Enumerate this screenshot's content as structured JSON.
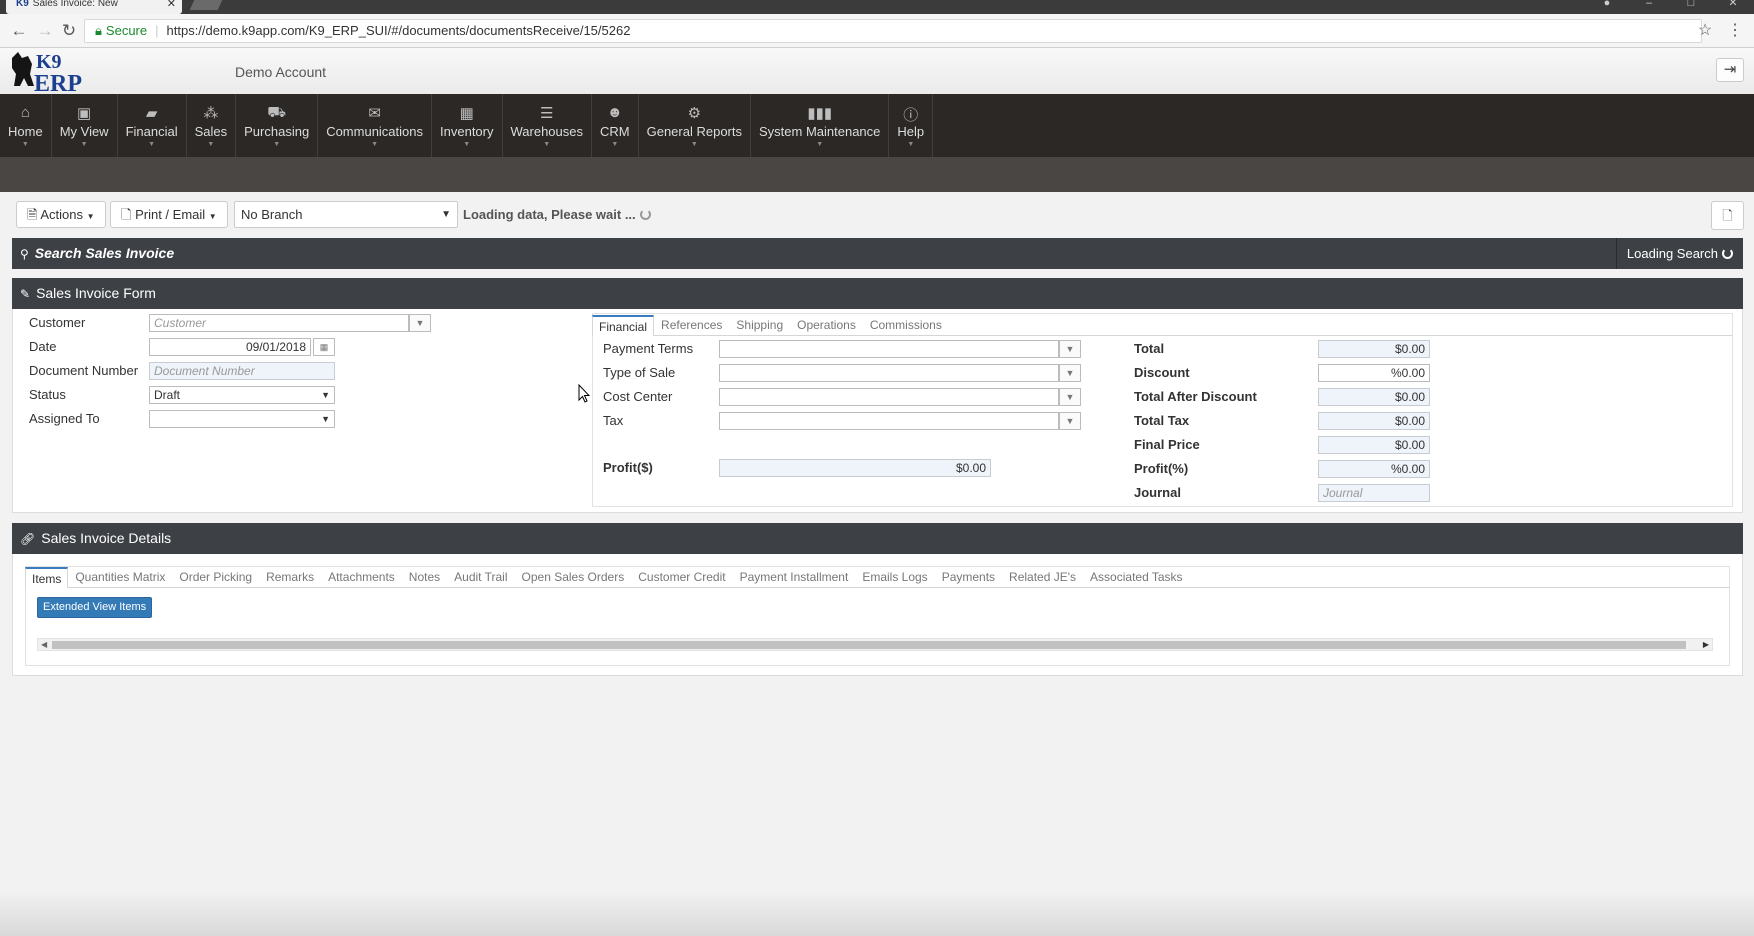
{
  "browser": {
    "tab_title": "Sales Invoice: New",
    "tab_favicon": "K9",
    "secure_label": "Secure",
    "url": "https://demo.k9app.com/K9_ERP_SUI/#/documents/documentsReceive/15/5262"
  },
  "header": {
    "logo_text": "K9 ERP",
    "account_name": "Demo Account"
  },
  "nav": {
    "items": [
      {
        "label": "Home",
        "icon": "home-icon"
      },
      {
        "label": "My View",
        "icon": "briefcase-icon"
      },
      {
        "label": "Financial",
        "icon": "book-icon"
      },
      {
        "label": "Sales",
        "icon": "cubes-icon"
      },
      {
        "label": "Purchasing",
        "icon": "cart-icon"
      },
      {
        "label": "Communications",
        "icon": "envelope-icon"
      },
      {
        "label": "Inventory",
        "icon": "table-icon"
      },
      {
        "label": "Warehouses",
        "icon": "server-icon"
      },
      {
        "label": "CRM",
        "icon": "users-icon"
      },
      {
        "label": "General Reports",
        "icon": "gear-icon"
      },
      {
        "label": "System Maintenance",
        "icon": "bar-chart-icon"
      },
      {
        "label": "Help",
        "icon": "info-icon"
      }
    ]
  },
  "actionbar": {
    "actions_label": "Actions",
    "print_label": "Print / Email",
    "branch_value": "No Branch",
    "loading_text": "Loading data, Please wait ..."
  },
  "search_panel": {
    "title": "Search Sales Invoice",
    "loading_label": "Loading Search"
  },
  "form_panel": {
    "title": "Sales Invoice Form",
    "customer_label": "Customer",
    "customer_placeholder": "Customer",
    "date_label": "Date",
    "date_value": "09/01/2018",
    "docnum_label": "Document Number",
    "docnum_placeholder": "Document Number",
    "status_label": "Status",
    "status_value": "Draft",
    "assigned_label": "Assigned To",
    "assigned_value": "",
    "tabs": [
      "Financial",
      "References",
      "Shipping",
      "Operations",
      "Commissions"
    ],
    "payment_terms_label": "Payment Terms",
    "type_of_sale_label": "Type of Sale",
    "cost_center_label": "Cost Center",
    "tax_label": "Tax",
    "profit_label": "Profit($)",
    "profit_value": "$0.00",
    "totals": [
      {
        "label": "Total",
        "value": "$0.00"
      },
      {
        "label": "Discount",
        "value": "%0.00"
      },
      {
        "label": "Total After Discount",
        "value": "$0.00"
      },
      {
        "label": "Total Tax",
        "value": "$0.00"
      },
      {
        "label": "Final Price",
        "value": "$0.00"
      },
      {
        "label": "Profit(%)",
        "value": "%0.00"
      }
    ],
    "journal_label": "Journal",
    "journal_placeholder": "Journal"
  },
  "details_panel": {
    "title": "Sales Invoice Details",
    "tabs": [
      "Items",
      "Quantities Matrix",
      "Order Picking",
      "Remarks",
      "Attachments",
      "Notes",
      "Audit Trail",
      "Open Sales Orders",
      "Customer Credit",
      "Payment Installment",
      "Emails Logs",
      "Payments",
      "Related JE's",
      "Associated Tasks"
    ],
    "extended_view_label": "Extended View Items"
  },
  "colors": {
    "nav_bg": "#2b2825",
    "panel_header_bg": "#3d4145",
    "primary_button": "#337ab7"
  }
}
